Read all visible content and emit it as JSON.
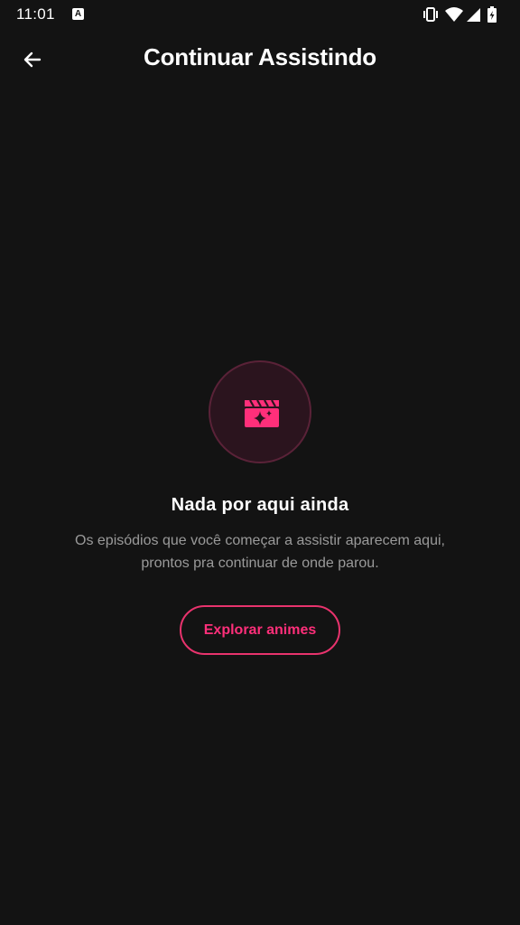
{
  "status_bar": {
    "time": "11:01",
    "notification_icon": "A",
    "right_icons": [
      "vibrate-icon",
      "wifi-icon",
      "signal-icon",
      "battery-charging-icon"
    ]
  },
  "app_bar": {
    "back_icon": "arrow-left-icon",
    "title": "Continuar Assistindo"
  },
  "empty_state": {
    "icon": "movie-clapper-sparkle-icon",
    "title": "Nada por aqui ainda",
    "description": "Os episódios que você começar a assistir aparecem aqui, prontos pra continuar de onde parou.",
    "button_label": "Explorar animes"
  },
  "colors": {
    "background": "#131313",
    "accent": "#ff2f7a",
    "icon_circle_bg": "#2b141e",
    "icon_circle_border": "#5a2238",
    "muted_text": "#9a9a9a"
  }
}
